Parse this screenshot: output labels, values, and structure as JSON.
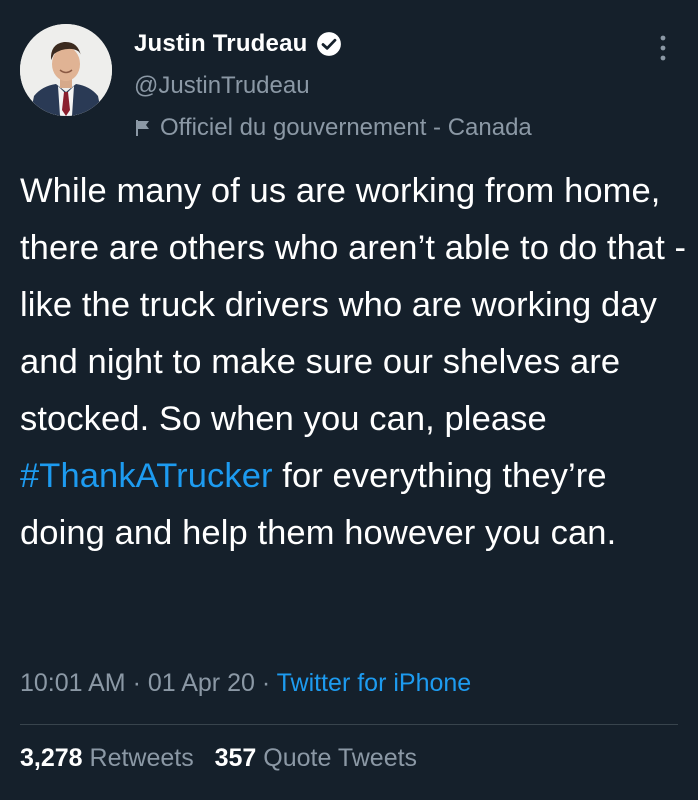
{
  "author": {
    "display_name": "Justin Trudeau",
    "handle": "@JustinTrudeau",
    "label": "Officiel du gouvernement - Canada",
    "avatar_icon": "profile-photo",
    "verified_icon": "verified-badge-icon"
  },
  "tweet": {
    "text_before": "While many of us are working from home, there are others who aren’t able to do that - like the truck drivers who are working day and night to make sure our shelves are stocked. So when you can, please ",
    "hashtag": "#ThankATrucker",
    "text_after": " for everything they’re doing and help them however you can."
  },
  "meta": {
    "time": "10:01 AM",
    "separator1": " · ",
    "date": "01 Apr 20",
    "separator2": " · ",
    "source": "Twitter for iPhone"
  },
  "stats": {
    "retweets_count": "3,278",
    "retweets_label": "Retweets",
    "quotes_count": "357",
    "quotes_label": "Quote Tweets"
  },
  "colors": {
    "background": "#15202b",
    "link": "#1d9bf0",
    "secondary_text": "#8b98a5",
    "divider": "#38444d"
  }
}
